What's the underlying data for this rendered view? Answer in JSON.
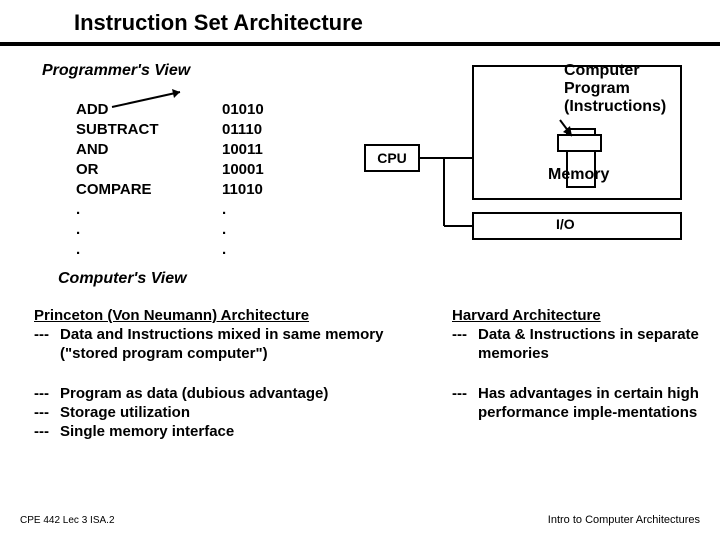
{
  "title": "Instruction Set Architecture",
  "views": {
    "programmer": "Programmer's View",
    "computer": "Computer's View"
  },
  "mnemonics": [
    "ADD",
    "SUBTRACT",
    "AND",
    "OR",
    "COMPARE",
    ".",
    ".",
    "."
  ],
  "binary": [
    "01010",
    "01110",
    "10011",
    "10001",
    "11010",
    ".",
    ".",
    "."
  ],
  "diagram": {
    "cpu": "CPU",
    "memory": "Memory",
    "io": "I/O",
    "program": "Computer\nProgram\n(Instructions)"
  },
  "princeton": {
    "heading": "Princeton (Von Neumann) Architecture",
    "p1": "Data and Instructions mixed in same memory (\"stored program computer\")",
    "p2": "Program as data (dubious advantage)",
    "p3": "Storage utilization",
    "p4": "Single memory interface"
  },
  "harvard": {
    "heading": "Harvard Architecture",
    "p1": "Data & Instructions in separate memories",
    "p2": "Has advantages in certain high performance imple-mentations"
  },
  "bullet": "---",
  "footer": {
    "left": "CPE 442  Lec 3 ISA.2",
    "right": "Intro to Computer Architectures"
  }
}
